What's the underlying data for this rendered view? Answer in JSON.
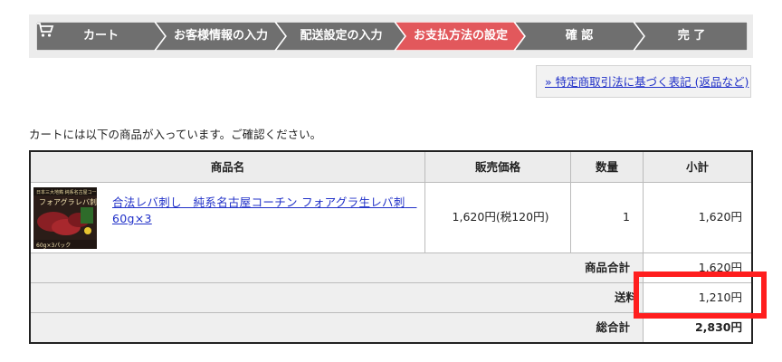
{
  "steps": [
    {
      "label": "カート",
      "active": false
    },
    {
      "label": "お客様情報の入力",
      "active": false
    },
    {
      "label": "配送設定の入力",
      "active": false
    },
    {
      "label": "お支払方法の設定",
      "active": true
    },
    {
      "label": "確 認",
      "active": false
    },
    {
      "label": "完 了",
      "active": false
    }
  ],
  "colors": {
    "step_default": "#6f6f6f",
    "step_active": "#e2585c",
    "link": "#2030c8",
    "highlight": "#ff1e1e"
  },
  "law_link": "» 特定商取引法に基づく表記 (返品など)",
  "notice": "カートには以下の商品が入っています。ご確認ください。",
  "table": {
    "headers": {
      "name": "商品名",
      "price": "販売価格",
      "qty": "数量",
      "subtotal": "小計"
    },
    "items": [
      {
        "image_icon": "liver-sashimi-product-photo",
        "name": "合法レバ刺し　純系名古屋コーチン フォアグラ生レバ刺　60g×3",
        "price": "1,620円(税120円)",
        "qty": "1",
        "subtotal": "1,620円"
      }
    ],
    "summary": {
      "items_total_label": "商品合計",
      "items_total": "1,620円",
      "shipping_label": "送料",
      "shipping": "1,210円",
      "grand_total_label": "総合計",
      "grand_total": "2,830円"
    }
  }
}
